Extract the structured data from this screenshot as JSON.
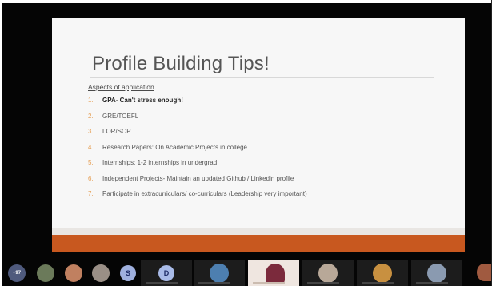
{
  "slide": {
    "title": "Profile Building Tips!",
    "subheading": "Aspects of application",
    "items": [
      {
        "num": "1.",
        "text": "GPA- Can't stress enough!",
        "bold": true
      },
      {
        "num": "2.",
        "text": "GRE/TOEFL"
      },
      {
        "num": "3.",
        "text": "LOR/SOP"
      },
      {
        "num": "4.",
        "text": "Research Papers: On Academic Projects in college"
      },
      {
        "num": "5.",
        "text": "Internships: 1-2 internships in undergrad"
      },
      {
        "num": "6.",
        "text": "Independent Projects- Maintain an updated Github / Linkedin profile"
      },
      {
        "num": "7.",
        "text": "Participate in extracurriculars/ co-curriculars (Leadership very important)"
      }
    ],
    "footer_color": "#c8581f",
    "number_color": "#e6a057"
  },
  "participants": {
    "badges": [
      "+97",
      "S",
      "D"
    ]
  }
}
